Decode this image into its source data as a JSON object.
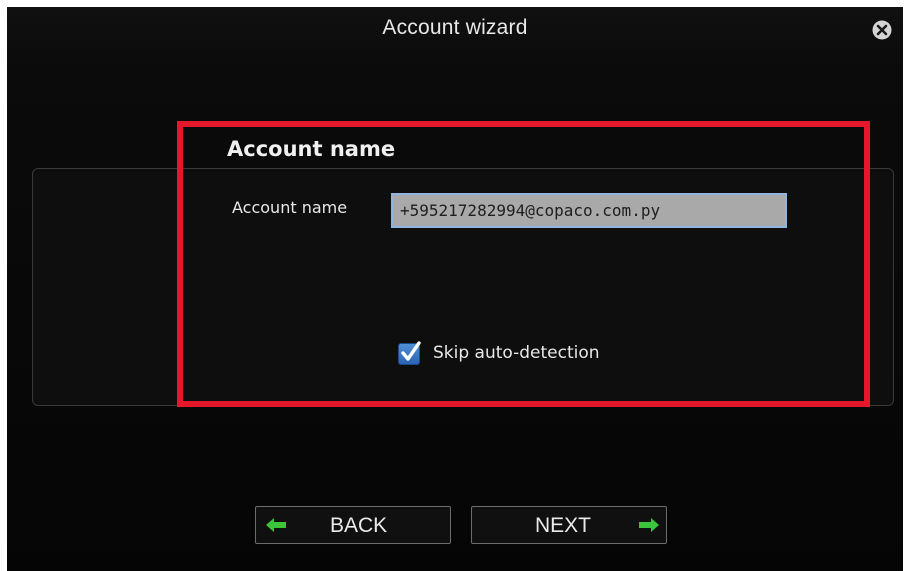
{
  "window": {
    "title": "Account wizard"
  },
  "section": {
    "title": "Account name"
  },
  "form": {
    "account_name_label": "Account name",
    "account_name_value": "+595217282994@copaco.com.py",
    "skip_autodetect_label": "Skip auto-detection",
    "skip_autodetect_checked": true
  },
  "buttons": {
    "back_label": "BACK",
    "next_label": "NEXT"
  },
  "colors": {
    "highlight": "#e3192b",
    "arrow": "#3cc43c",
    "checkbox": "#3a78c8"
  },
  "icons": {
    "close": "close-icon",
    "check": "checkmark-icon",
    "back": "arrow-left-icon",
    "next": "arrow-right-icon"
  }
}
